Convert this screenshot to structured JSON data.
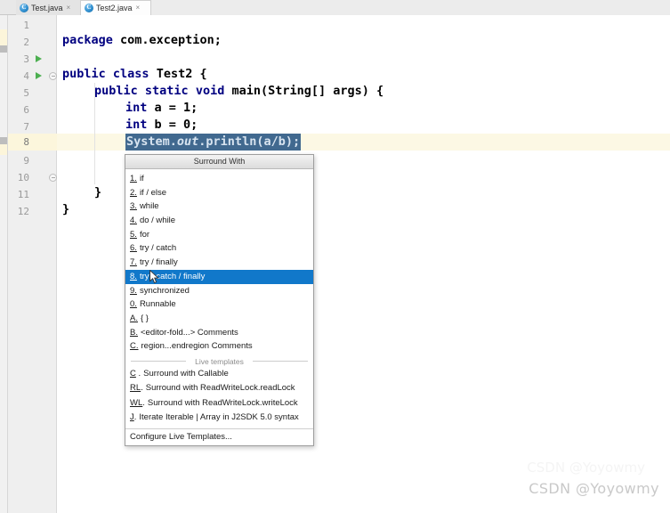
{
  "app": {
    "kind": "java-ide-editor",
    "accent_selection": "#1178ca",
    "editor_selection_bg": "#41698f",
    "current_line_bg": "#fcf8e4"
  },
  "tabs": [
    {
      "label": "Test.java",
      "icon": "java-class-icon",
      "close": "×",
      "active": false
    },
    {
      "label": "Test2.java",
      "icon": "java-class-icon",
      "close": "×",
      "active": true
    }
  ],
  "gutter": {
    "line_numbers": [
      "1",
      "2",
      "3",
      "4",
      "5",
      "6",
      "7",
      "8",
      "9",
      "10",
      "11",
      "12"
    ],
    "highlighted_line": "8",
    "run_markers": [
      "3",
      "4"
    ],
    "fold_markers": [
      "4",
      "10"
    ]
  },
  "code": {
    "line1_kw": "package",
    "line1_rest": " com.exception;",
    "line3_kw1": "public",
    "line3_kw2": "class",
    "line3_name": "Test2",
    "line3_brace": "{",
    "line4": "    public static void main(String[] args) {",
    "line4_kw1": "public",
    "line4_kw2": "static",
    "line4_kw3": "void",
    "line4_rest": " main(String[] args) {",
    "line5_kw": "int",
    "line5_rest": " a = 1;",
    "line6_kw": "int",
    "line6_rest": " b = 0;",
    "line10": "}",
    "line11": "}",
    "selected_line_a": "System.",
    "selected_line_b": "out",
    "selected_line_c": ".println(a/b);"
  },
  "popup": {
    "title": "Surround With",
    "items": [
      {
        "mnemonic": "1.",
        "label": "if",
        "selected": false
      },
      {
        "mnemonic": "2.",
        "label": "if / else",
        "selected": false
      },
      {
        "mnemonic": "3.",
        "label": "while",
        "selected": false
      },
      {
        "mnemonic": "4.",
        "label": "do / while",
        "selected": false
      },
      {
        "mnemonic": "5.",
        "label": "for",
        "selected": false
      },
      {
        "mnemonic": "6.",
        "label": "try / catch",
        "selected": false
      },
      {
        "mnemonic": "7.",
        "label": "try / finally",
        "selected": false
      },
      {
        "mnemonic": "8.",
        "label": "try / catch / finally",
        "selected": true
      },
      {
        "mnemonic": "9.",
        "label": "synchronized",
        "selected": false
      },
      {
        "mnemonic": "0.",
        "label": "Runnable",
        "selected": false
      },
      {
        "mnemonic": "A.",
        "label": "{ }",
        "selected": false
      },
      {
        "mnemonic": "B.",
        "label": "<editor-fold...> Comments",
        "selected": false
      },
      {
        "mnemonic": "C.",
        "label": "region...endregion Comments",
        "selected": false
      }
    ],
    "section_label": "Live templates",
    "templates": [
      {
        "abbr_u": "C",
        "abbr_rest": " .",
        "label": "Surround with Callable"
      },
      {
        "abbr_u": "RL",
        "abbr_rest": ".",
        "label": "Surround with ReadWriteLock.readLock"
      },
      {
        "abbr_u": "WL",
        "abbr_rest": ".",
        "label": "Surround with ReadWriteLock.writeLock"
      },
      {
        "abbr_u": "J",
        "abbr_rest": ".",
        "label": "Iterate Iterable | Array in J2SDK 5.0 syntax"
      }
    ],
    "footer": "Configure Live Templates..."
  },
  "watermark": {
    "text": "CSDN @Yoyowmy"
  }
}
